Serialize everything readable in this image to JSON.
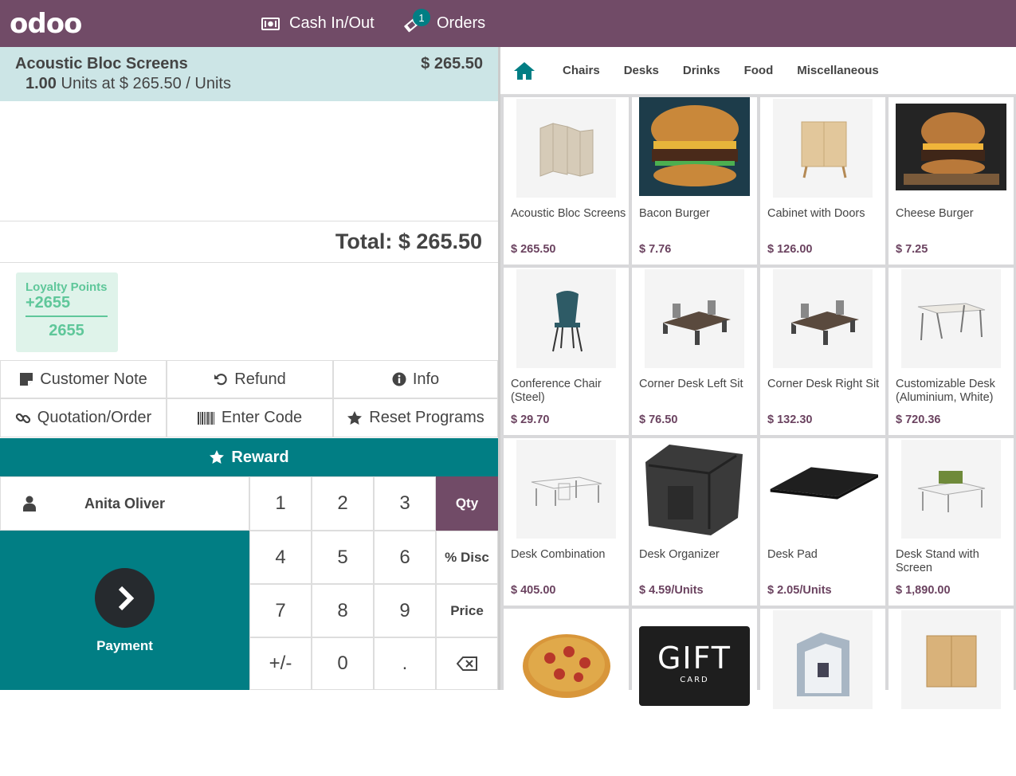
{
  "header": {
    "logo": "odoo",
    "cash_in_out": "Cash In/Out",
    "orders_label": "Orders",
    "orders_count": "1"
  },
  "order": {
    "line_name": "Acoustic Bloc Screens",
    "line_price": "$ 265.50",
    "line_qty": "1.00",
    "line_unit_info": "Units at $ 265.50 / Units",
    "total": "Total: $ 265.50"
  },
  "loyalty": {
    "title": "Loyalty Points",
    "won": "+2655",
    "total": "2655"
  },
  "controls": {
    "customer_note": "Customer Note",
    "refund": "Refund",
    "info": "Info",
    "quotation": "Quotation/Order",
    "enter_code": "Enter Code",
    "reset_programs": "Reset Programs",
    "reward": "Reward"
  },
  "customer": {
    "name": "Anita Oliver"
  },
  "payment": {
    "label": "Payment"
  },
  "numpad": {
    "k1": "1",
    "k2": "2",
    "k3": "3",
    "qty": "Qty",
    "k4": "4",
    "k5": "5",
    "k6": "6",
    "disc": "% Disc",
    "k7": "7",
    "k8": "8",
    "k9": "9",
    "price": "Price",
    "sign": "+/-",
    "k0": "0",
    "dot": "."
  },
  "categories": [
    "Chairs",
    "Desks",
    "Drinks",
    "Food",
    "Miscellaneous"
  ],
  "products": [
    {
      "name": "Acoustic Bloc Screens",
      "price": "$ 265.50"
    },
    {
      "name": "Bacon Burger",
      "price": "$ 7.76"
    },
    {
      "name": "Cabinet with Doors",
      "price": "$ 126.00"
    },
    {
      "name": "Cheese Burger",
      "price": "$ 7.25"
    },
    {
      "name": "Conference Chair (Steel)",
      "price": "$ 29.70"
    },
    {
      "name": "Corner Desk Left Sit",
      "price": "$ 76.50"
    },
    {
      "name": "Corner Desk Right Sit",
      "price": "$ 132.30"
    },
    {
      "name": "Customizable Desk (Aluminium, White)",
      "price": "$ 720.36"
    },
    {
      "name": "Desk Combination",
      "price": "$ 405.00"
    },
    {
      "name": "Desk Organizer",
      "price": "$ 4.59/Units"
    },
    {
      "name": "Desk Pad",
      "price": "$ 2.05/Units"
    },
    {
      "name": "Desk Stand with Screen",
      "price": "$ 1,890.00"
    }
  ],
  "gift_card": {
    "big": "GIFT",
    "small": "CARD"
  },
  "colors": {
    "brand": "#714b67",
    "teal": "#017e84",
    "selected_line": "#cce5e6",
    "loyalty": "#5fc79a"
  }
}
